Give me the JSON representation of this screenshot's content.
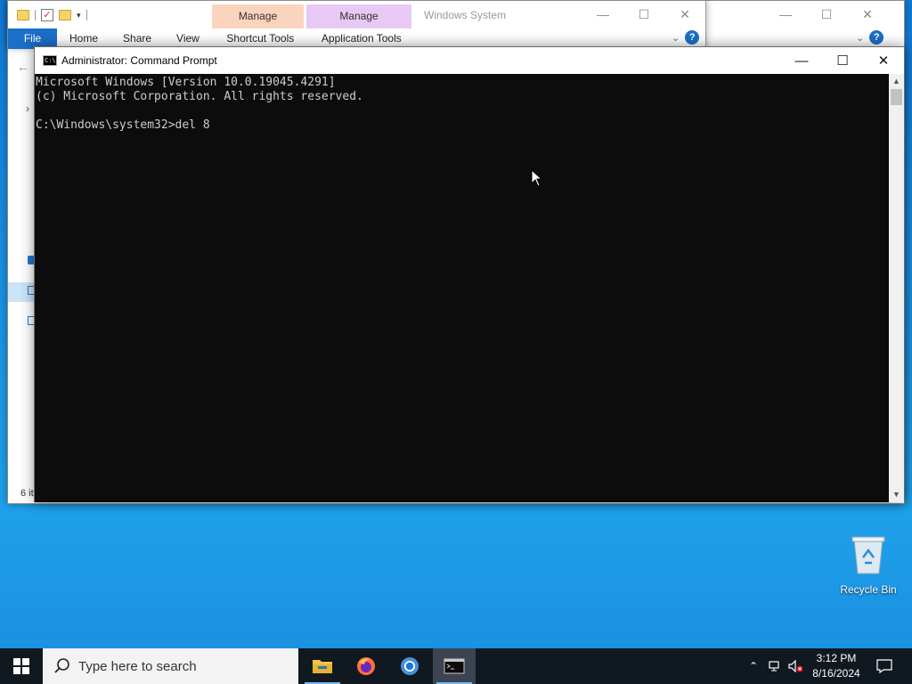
{
  "explorer_back": {
    "title": "Windows System",
    "ribbon_tabs": [
      "Home",
      "Share",
      "View"
    ],
    "file_tab": "File",
    "status": "6 it"
  },
  "explorer_front": {
    "ctx_shortcut_label": "Manage",
    "ctx_app_label": "Manage",
    "shortcut_tools": "Shortcut Tools",
    "application_tools": "Application Tools",
    "title": "Windows System",
    "file_tab": "File",
    "ribbon_tabs": [
      "Home",
      "Share",
      "View"
    ]
  },
  "cmd": {
    "title": "Administrator: Command Prompt",
    "lines": [
      "Microsoft Windows [Version 10.0.19045.4291]",
      "(c) Microsoft Corporation. All rights reserved.",
      "",
      "C:\\Windows\\system32>del 8"
    ]
  },
  "desktop": {
    "recycle_bin_label": "Recycle Bin"
  },
  "taskbar": {
    "search_placeholder": "Type here to search",
    "apps": [
      "file-explorer",
      "firefox",
      "chrome",
      "command-prompt"
    ],
    "active_app": "command-prompt",
    "time": "3:12 PM",
    "date": "8/16/2024"
  },
  "colors": {
    "accent": "#1a6fc9",
    "console_bg": "#0c0c0c",
    "console_fg": "#cccccc",
    "taskbar_bg": "#101820",
    "ctx_shortcut": "#fbd4bd",
    "ctx_app": "#e8c9f5"
  }
}
